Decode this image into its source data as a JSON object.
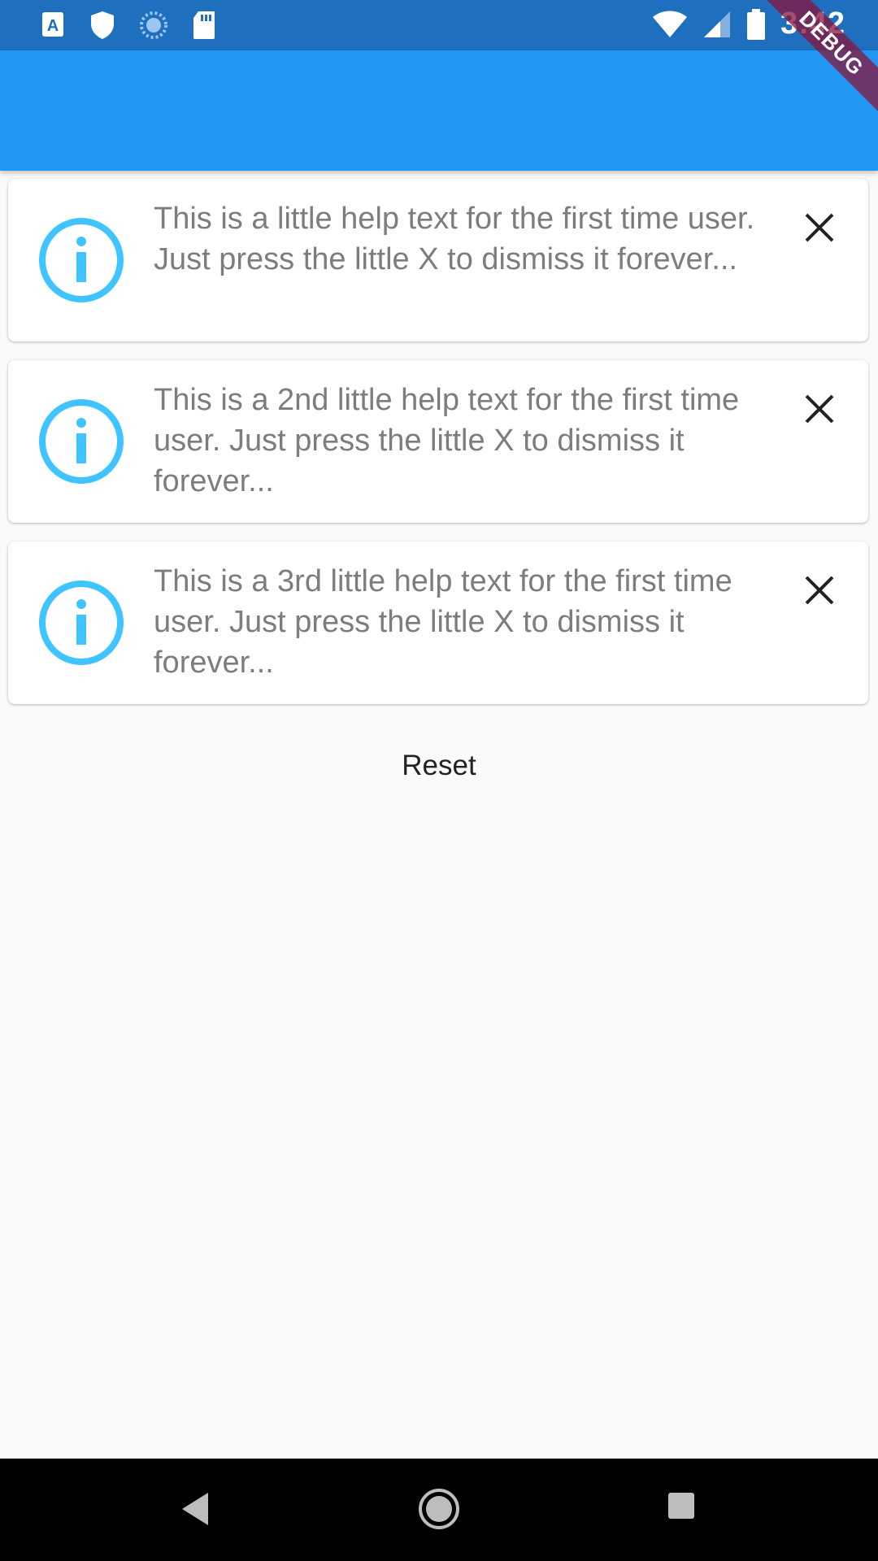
{
  "status_bar": {
    "time": "3:42",
    "left_icons": [
      "font-a-icon",
      "shield-icon",
      "sync-circle-icon",
      "sd-card-icon"
    ],
    "right_icons": [
      "wifi-icon",
      "signal-icon",
      "battery-icon"
    ]
  },
  "debug_banner": "DEBUG",
  "app_bar": {
    "title": "",
    "color": "#2196f3"
  },
  "cards": [
    {
      "icon": "info-icon",
      "text": "This is a little help text for the first time user. Just press the little X to dismiss it forever...",
      "close_icon": "close-icon"
    },
    {
      "icon": "info-icon",
      "text": "This is a 2nd little help text for the first time user. Just press the little X to dismiss it forever...",
      "close_icon": "close-icon"
    },
    {
      "icon": "info-icon",
      "text": "This is a 3rd little help text for the first time user. Just press the little X to dismiss it forever...",
      "close_icon": "close-icon"
    }
  ],
  "reset_label": "Reset",
  "colors": {
    "accent": "#2196f3",
    "status_bar": "#1e70bf",
    "info_icon": "#40c4ff",
    "text_muted": "#7d7d7d"
  },
  "nav_bar": {
    "buttons": [
      "back-icon",
      "home-icon",
      "recents-icon"
    ]
  }
}
